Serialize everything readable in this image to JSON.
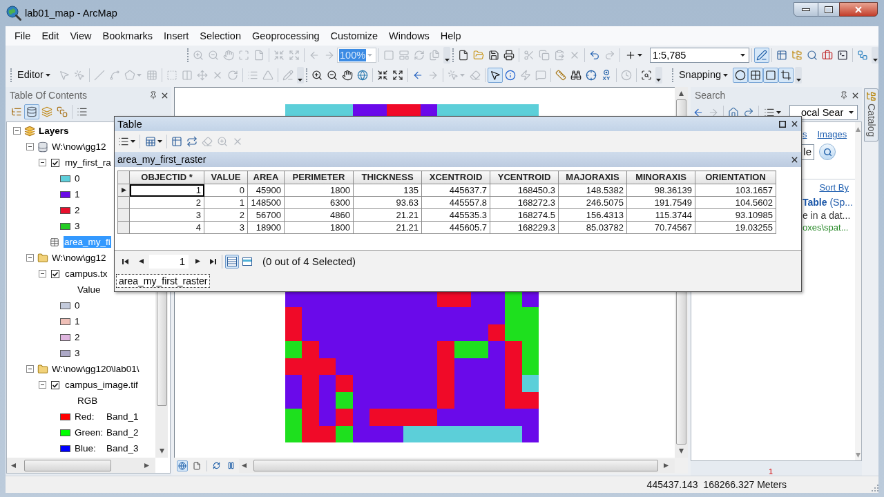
{
  "window": {
    "title": "lab01_map - ArcMap"
  },
  "menu": [
    "File",
    "Edit",
    "View",
    "Bookmarks",
    "Insert",
    "Selection",
    "Geoprocessing",
    "Customize",
    "Windows",
    "Help"
  ],
  "toolbars": {
    "layout": [
      [
        {
          "kind": "tool",
          "disabled": true,
          "pressed": false
        },
        {
          "kind": "tool",
          "disabled": true,
          "pressed": false
        },
        {
          "kind": "tool",
          "disabled": true,
          "pressed": false
        },
        {
          "kind": "tool",
          "disabled": true,
          "pressed": false
        },
        {
          "kind": "tool",
          "disabled": true,
          "pressed": false
        }
      ],
      [
        {
          "kind": "tool",
          "disabled": true,
          "pressed": false
        },
        {
          "kind": "tool",
          "disabled": true,
          "pressed": false
        }
      ],
      [
        {
          "kind": "tool",
          "disabled": true,
          "pressed": false
        },
        {
          "kind": "tool",
          "disabled": true,
          "pressed": false
        },
        {
          "kind": "combo",
          "value": "100%",
          "disabled": true
        }
      ],
      [
        {
          "kind": "tool",
          "disabled": true,
          "pressed": false
        },
        {
          "kind": "tool",
          "disabled": true,
          "pressed": false
        },
        {
          "kind": "tool",
          "disabled": true,
          "pressed": false
        },
        {
          "kind": "tool",
          "disabled": true,
          "pressed": false
        }
      ]
    ],
    "standard": [
      [
        {
          "kind": "tool",
          "disabled": false,
          "pressed": false
        },
        {
          "kind": "tool",
          "disabled": false,
          "pressed": false
        },
        {
          "kind": "tool",
          "disabled": false,
          "pressed": false
        },
        {
          "kind": "tool",
          "disabled": false,
          "pressed": false
        }
      ],
      [
        {
          "kind": "tool",
          "disabled": true,
          "pressed": false
        },
        {
          "kind": "tool",
          "disabled": true,
          "pressed": false
        },
        {
          "kind": "tool",
          "disabled": true,
          "pressed": false
        },
        {
          "kind": "tool",
          "disabled": true,
          "pressed": false
        }
      ],
      [
        {
          "kind": "tool",
          "disabled": false,
          "pressed": false
        },
        {
          "kind": "tool",
          "disabled": true,
          "pressed": false
        }
      ],
      [
        {
          "kind": "tool",
          "disabled": false,
          "pressed": false
        },
        {
          "kind": "combo",
          "value": "1:5,785",
          "disabled": false
        }
      ],
      [
        {
          "kind": "tool",
          "disabled": false,
          "pressed": true
        }
      ],
      [
        {
          "kind": "tool",
          "disabled": false,
          "pressed": false
        },
        {
          "kind": "tool",
          "disabled": false,
          "pressed": false
        },
        {
          "kind": "tool",
          "disabled": false,
          "pressed": false
        },
        {
          "kind": "tool",
          "disabled": false,
          "pressed": false
        },
        {
          "kind": "tool",
          "disabled": false,
          "pressed": false
        }
      ],
      [
        {
          "kind": "tool",
          "disabled": false,
          "pressed": false
        }
      ]
    ],
    "editor": [
      [
        {
          "kind": "menu",
          "label": "Editor"
        },
        {
          "kind": "tool",
          "disabled": true,
          "pressed": false
        },
        {
          "kind": "tool",
          "disabled": true,
          "pressed": false
        }
      ],
      [
        {
          "kind": "tool",
          "disabled": true,
          "pressed": false
        },
        {
          "kind": "tool",
          "disabled": true,
          "pressed": false
        },
        {
          "kind": "tool",
          "disabled": true,
          "pressed": false
        },
        {
          "kind": "tool",
          "disabled": true,
          "pressed": false
        }
      ],
      [
        {
          "kind": "tool",
          "disabled": true,
          "pressed": false
        },
        {
          "kind": "tool",
          "disabled": true,
          "pressed": false
        },
        {
          "kind": "tool",
          "disabled": true,
          "pressed": false
        },
        {
          "kind": "tool",
          "disabled": true,
          "pressed": false
        },
        {
          "kind": "tool",
          "disabled": true,
          "pressed": false
        }
      ],
      [
        {
          "kind": "tool",
          "disabled": true,
          "pressed": false
        },
        {
          "kind": "tool",
          "disabled": true,
          "pressed": false
        }
      ],
      [
        {
          "kind": "tool",
          "disabled": true,
          "pressed": false
        }
      ]
    ],
    "tools": [
      [
        {
          "kind": "tool",
          "disabled": false,
          "pressed": false
        },
        {
          "kind": "tool",
          "disabled": false,
          "pressed": false
        },
        {
          "kind": "tool",
          "disabled": false,
          "pressed": false
        },
        {
          "kind": "tool",
          "disabled": false,
          "pressed": false
        }
      ],
      [
        {
          "kind": "tool",
          "disabled": false,
          "pressed": false
        },
        {
          "kind": "tool",
          "disabled": false,
          "pressed": false
        }
      ],
      [
        {
          "kind": "tool",
          "disabled": false,
          "pressed": false
        },
        {
          "kind": "tool",
          "disabled": true,
          "pressed": false
        }
      ],
      [
        {
          "kind": "tool",
          "disabled": true,
          "pressed": false
        },
        {
          "kind": "tool",
          "disabled": true,
          "pressed": false
        }
      ],
      [
        {
          "kind": "tool",
          "disabled": false,
          "pressed": true
        },
        {
          "kind": "tool",
          "disabled": false,
          "pressed": false
        },
        {
          "kind": "tool",
          "disabled": true,
          "pressed": false
        },
        {
          "kind": "tool",
          "disabled": true,
          "pressed": false
        }
      ],
      [
        {
          "kind": "tool",
          "disabled": false,
          "pressed": false
        },
        {
          "kind": "tool",
          "disabled": false,
          "pressed": false
        },
        {
          "kind": "tool",
          "disabled": false,
          "pressed": false
        },
        {
          "kind": "label",
          "label": "XY",
          "disabled": false
        }
      ],
      [
        {
          "kind": "tool",
          "disabled": true,
          "pressed": false
        }
      ],
      [
        {
          "kind": "tool",
          "disabled": false,
          "pressed": false
        }
      ]
    ],
    "snapping": [
      [
        {
          "kind": "menu",
          "label": "Snapping"
        },
        {
          "kind": "tool",
          "disabled": false,
          "pressed": true
        },
        {
          "kind": "tool",
          "disabled": false,
          "pressed": true
        },
        {
          "kind": "tool",
          "disabled": false,
          "pressed": true
        },
        {
          "kind": "tool",
          "disabled": false,
          "pressed": true
        }
      ]
    ]
  },
  "toc": {
    "title": "Table Of Contents",
    "tools": [
      [
        {
          "kind": "tool",
          "disabled": false,
          "pressed": false
        },
        {
          "kind": "tool",
          "disabled": false,
          "pressed": true
        },
        {
          "kind": "tool",
          "disabled": false,
          "pressed": false
        },
        {
          "kind": "tool",
          "disabled": false,
          "pressed": false
        }
      ],
      [
        {
          "kind": "tool",
          "disabled": false,
          "pressed": false
        }
      ]
    ],
    "tree": [
      {
        "kind": "frame",
        "label": "Layers",
        "expanded": true,
        "selected": false,
        "children": [
          {
            "kind": "database",
            "label": "W:\\now\\gg12",
            "expanded": true,
            "selected": false,
            "children": [
              {
                "kind": "layer",
                "label": "my_first_ra",
                "checked": true,
                "expanded": true,
                "selected": false,
                "children": [
                  {
                    "kind": "class",
                    "label": "0",
                    "color": "#5ecfdb"
                  },
                  {
                    "kind": "class",
                    "label": "1",
                    "color": "#6a0ae8"
                  },
                  {
                    "kind": "class",
                    "label": "2",
                    "color": "#e8102c"
                  },
                  {
                    "kind": "class",
                    "label": "3",
                    "color": "#22cc22"
                  }
                ]
              },
              {
                "kind": "table",
                "label": "area_my_fi",
                "selected": true
              }
            ]
          },
          {
            "kind": "folder",
            "label": "W:\\now\\gg12",
            "expanded": true,
            "selected": false,
            "children": [
              {
                "kind": "layer",
                "label": "campus.tx",
                "checked": true,
                "expanded": true,
                "selected": false,
                "children": [
                  {
                    "kind": "heading",
                    "label": "Value"
                  },
                  {
                    "kind": "class",
                    "label": "0",
                    "color": "#c3cadb"
                  },
                  {
                    "kind": "class",
                    "label": "1",
                    "color": "#efbfb7"
                  },
                  {
                    "kind": "class",
                    "label": "2",
                    "color": "#dfb5df"
                  },
                  {
                    "kind": "class",
                    "label": "3",
                    "color": "#aca8c6"
                  }
                ]
              }
            ]
          },
          {
            "kind": "folder",
            "label": "W:\\now\\gg120\\lab01\\",
            "expanded": true,
            "selected": false,
            "children": [
              {
                "kind": "layer",
                "label": "campus_image.tif",
                "checked": true,
                "expanded": true,
                "selected": false,
                "children": [
                  {
                    "kind": "heading",
                    "label": "RGB"
                  },
                  {
                    "kind": "band",
                    "label": "Red:",
                    "value": "Band_1",
                    "color": "#ff0000"
                  },
                  {
                    "kind": "band",
                    "label": "Green:",
                    "value": "Band_2",
                    "color": "#00ff00"
                  },
                  {
                    "kind": "band",
                    "label": "Blue:",
                    "value": "Band_3",
                    "color": "#0000ff"
                  }
                ]
              }
            ]
          }
        ]
      }
    ]
  },
  "map": {
    "view_buttons": [
      {
        "selected": true
      },
      {
        "selected": false
      }
    ]
  },
  "search": {
    "title": "Search",
    "tools": [
      [
        {
          "kind": "tool",
          "disabled": false
        },
        {
          "kind": "tool",
          "disabled": true
        }
      ],
      [
        {
          "kind": "tool",
          "disabled": false
        },
        {
          "kind": "tool",
          "disabled": false
        }
      ],
      [
        {
          "kind": "tool",
          "disabled": false
        },
        {
          "kind": "combo",
          "value": "ocal Sear",
          "disabled": false
        }
      ]
    ],
    "links": [
      "s",
      "Images"
    ],
    "query": "le",
    "sort_link": "Sort By",
    "results": [
      {
        "title": "**Table** (Sp...",
        "snippet": "e in a dat...",
        "path": "oxes\\spat..."
      }
    ],
    "footer_number": "1"
  },
  "catalog_tab": {
    "label": "Catalog"
  },
  "status_bar": {
    "coordinates": "445437.143  168266.327 Meters"
  },
  "table_window": {
    "title": "Table",
    "tools": [
      [
        {
          "kind": "tool",
          "disabled": false
        }
      ],
      [
        {
          "kind": "tool",
          "disabled": false
        }
      ],
      [
        {
          "kind": "tool",
          "disabled": false
        },
        {
          "kind": "tool",
          "disabled": false
        },
        {
          "kind": "tool",
          "disabled": true
        },
        {
          "kind": "tool",
          "disabled": true
        },
        {
          "kind": "tool",
          "disabled": true
        }
      ]
    ],
    "table_name": "area_my_first_raster",
    "columns": [
      "OBJECTID *",
      "VALUE",
      "AREA",
      "PERIMETER",
      "THICKNESS",
      "XCENTROID",
      "YCENTROID",
      "MAJORAXIS",
      "MINORAXIS",
      "ORIENTATION"
    ],
    "rows": [
      {
        "current": true,
        "cells": [
          "1",
          "0",
          "45900",
          "1800",
          "135",
          "445637.7",
          "168450.3",
          "148.5382",
          "98.36139",
          "103.1657"
        ]
      },
      {
        "current": false,
        "cells": [
          "2",
          "1",
          "148500",
          "6300",
          "93.63",
          "445557.8",
          "168272.3",
          "246.5075",
          "191.7549",
          "104.5602"
        ]
      },
      {
        "current": false,
        "cells": [
          "3",
          "2",
          "56700",
          "4860",
          "21.21",
          "445535.3",
          "168274.5",
          "156.4313",
          "115.3744",
          "93.10985"
        ]
      },
      {
        "current": false,
        "cells": [
          "4",
          "3",
          "18900",
          "1800",
          "21.21",
          "445605.7",
          "168229.3",
          "85.03782",
          "70.74567",
          "19.03255"
        ]
      }
    ],
    "record": "1",
    "views": [
      {
        "selected": true
      },
      {
        "selected": false
      }
    ],
    "selection_info": "(0 out of 4 Selected)",
    "tabs": [
      {
        "label": "area_my_first_raster",
        "selected": true
      }
    ]
  }
}
